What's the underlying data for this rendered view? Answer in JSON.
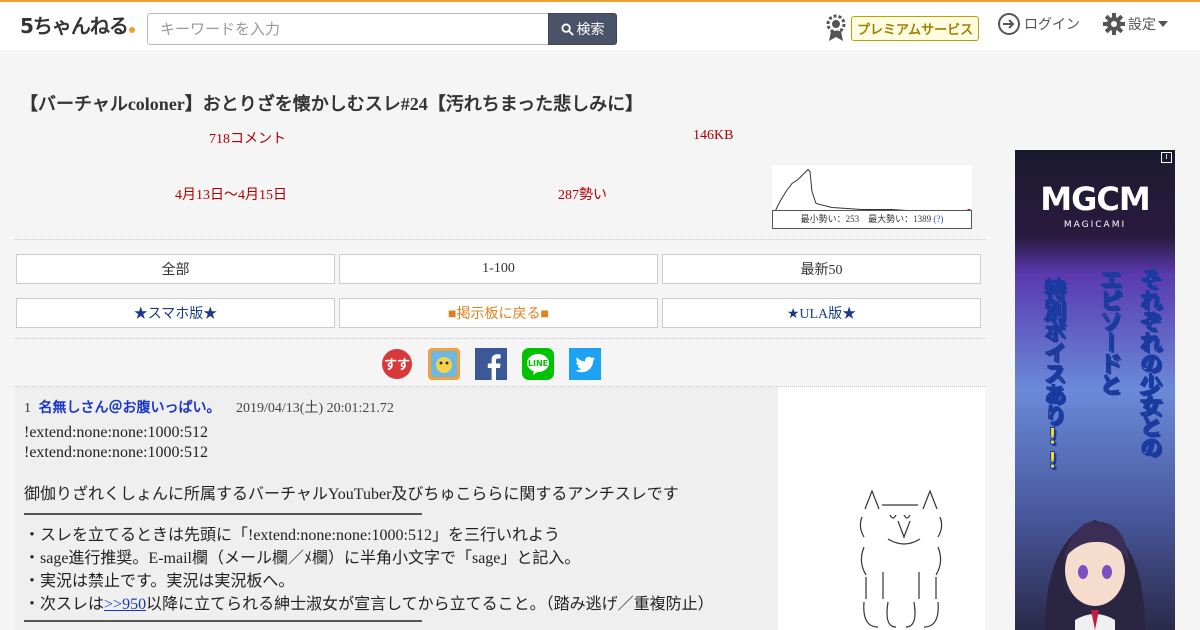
{
  "header": {
    "logo_text": "5ちゃんねる",
    "search_placeholder": "キーワードを入力",
    "search_button": "検索",
    "premium_label": "プレミアムサービス",
    "login_label": "ログイン",
    "settings_label": "設定"
  },
  "thread": {
    "title": "【バーチャルcoloner】おとりざを懐かしむスレ#24【汚れちまった悲しみに】",
    "comments": "718コメント",
    "size": "146KB",
    "date_range": "4月13日〜4月15日",
    "momentum": "287勢い",
    "graph_stats": "最小勢い：253　最大勢い：1389",
    "graph_help": "(?)"
  },
  "nav": {
    "all": "全部",
    "range": "1-100",
    "latest": "最新50",
    "smartphone": "★スマホ版★",
    "back_to_board": "■掲示板に戻る■",
    "ula": "★ULA版★"
  },
  "post": {
    "number": "1",
    "name": "名無しさん＠お腹いっぱい。",
    "date": "2019/04/13(土) 20:01:21.72",
    "lines": [
      "!extend:none:none:1000:512",
      "!extend:none:none:1000:512",
      "御伽りざれくしょんに所属するバーチャルYouTuber及びちゅこららに関するアンチスレです",
      "・スレを立てるときは先頭に「!extend:none:none:1000:512」を三行いれよう",
      "・sage進行推奨。E-mail欄（メール欄／ﾒ欄）に半角小文字で「sage」と記入。",
      "・実況は禁止です。実況は実況板へ。",
      "・次スレは",
      "以降に立てられる紳士淑女が宣言してから立てること。（踏み逃げ／重複防止）"
    ],
    "anchor": ">>950"
  },
  "ad": {
    "logo": "MGCM",
    "logo_sub": "MAGICAMI",
    "col1": "それぞれの少女との",
    "col2": "エピソードと",
    "col3": "特別ボイスあり!!"
  },
  "colors": {
    "accent": "#f0a030",
    "stat_red": "#b00000",
    "link_blue": "#1a35c8",
    "search_btn": "#4a5368"
  }
}
